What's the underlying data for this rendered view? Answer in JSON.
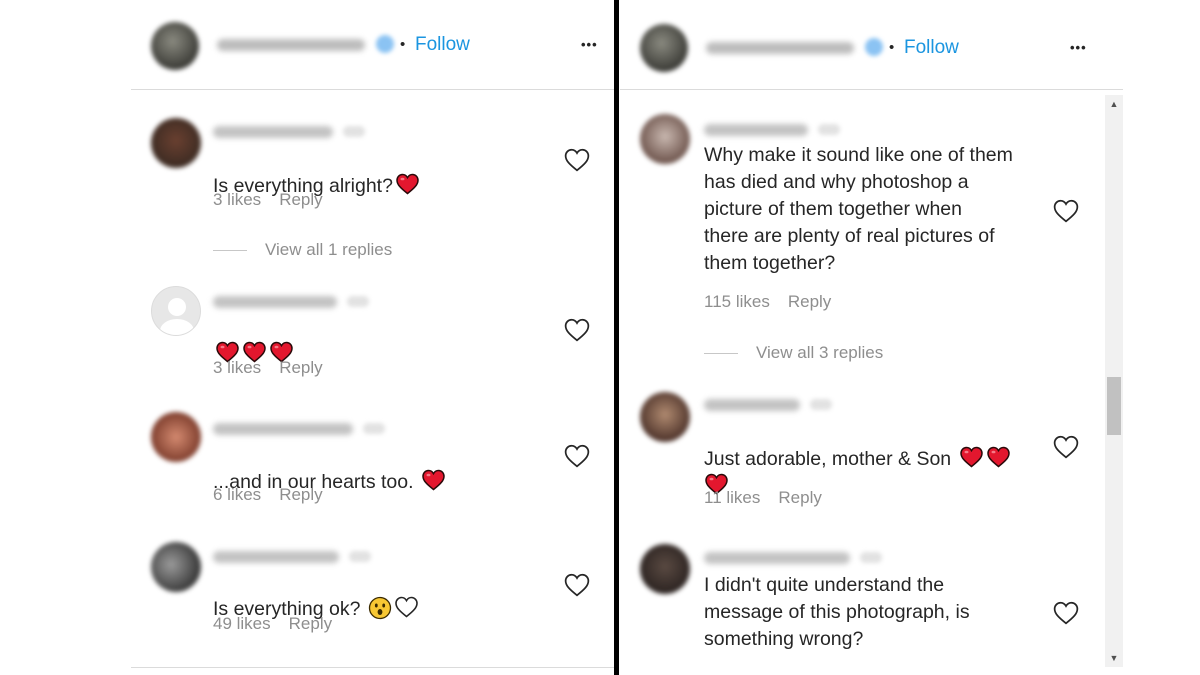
{
  "left_panel": {
    "header": {
      "dot": "•",
      "follow_label": "Follow",
      "more_label": "•••"
    },
    "comments": [
      {
        "text": "Is everything alright?",
        "emoji": [
          "red-heart"
        ],
        "likes": "3 likes",
        "reply": "Reply",
        "view_replies": "View all 1 replies"
      },
      {
        "text": "",
        "emoji": [
          "red-heart",
          "red-heart",
          "red-heart"
        ],
        "likes": "3 likes",
        "reply": "Reply"
      },
      {
        "text": "...and in our hearts too.",
        "emoji": [
          "red-heart"
        ],
        "likes": "6 likes",
        "reply": "Reply"
      },
      {
        "text": "Is everything ok?",
        "emoji": [
          "hushed-face",
          "white-heart"
        ],
        "likes": "49 likes",
        "reply": "Reply"
      }
    ]
  },
  "right_panel": {
    "header": {
      "dot": "•",
      "follow_label": "Follow",
      "more_label": "•••"
    },
    "comments": [
      {
        "text": "Why make it sound like one of them\nhas died and why photoshop a\npicture of them together when\nthere are plenty of real pictures of\nthem together?",
        "likes": "115 likes",
        "reply": "Reply",
        "view_replies": "View all 3 replies"
      },
      {
        "text": "Just adorable, mother & Son",
        "emoji": [
          "red-heart",
          "red-heart",
          "red-heart"
        ],
        "likes": "11 likes",
        "reply": "Reply"
      },
      {
        "text": "I didn't quite understand the\nmessage of this photograph, is\nsomething wrong?"
      }
    ],
    "scrollbar": {
      "up_arrow": "▲",
      "down_arrow": "▼"
    }
  },
  "colors": {
    "follow": "#1b95e0",
    "divider": "#000000",
    "heart_red": "#e3172e",
    "meta_gray": "#8e8e8e"
  }
}
